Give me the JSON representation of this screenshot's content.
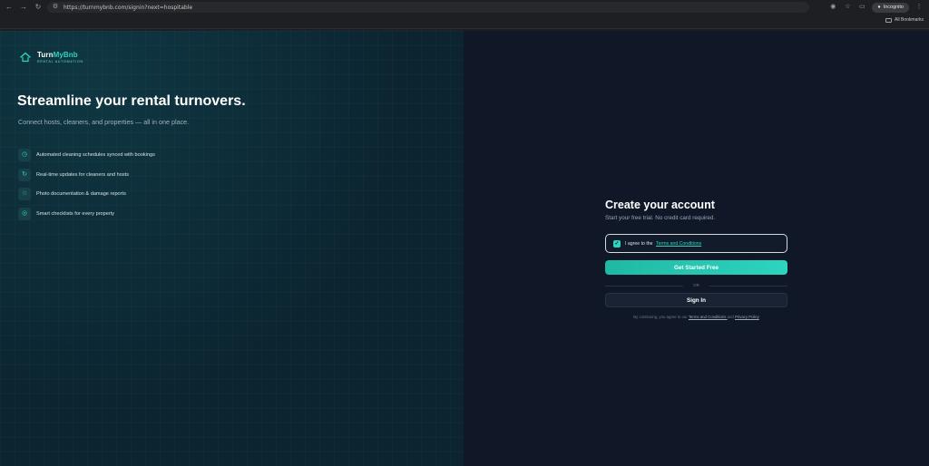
{
  "browser": {
    "url": "https://turnmybnb.com/signin?next=hospitable",
    "mode_label": "Incognito",
    "bookmarks_label": "All Bookmarks"
  },
  "brand": {
    "name_part1": "Turn",
    "name_part2": "MyBnb",
    "tagline": "RENTAL AUTOMATION",
    "accent_color": "#2dd4bf"
  },
  "hero": {
    "headline": "Streamline your rental turnovers.",
    "subheadline": "Connect hosts, cleaners, and properties — all in one place."
  },
  "features": [
    {
      "icon": "clock-icon",
      "text": "Automated cleaning schedules synced with bookings"
    },
    {
      "icon": "refresh-icon",
      "text": "Real-time updates for cleaners and hosts"
    },
    {
      "icon": "camera-icon",
      "text": "Photo documentation & damage reports"
    },
    {
      "icon": "checklist-icon",
      "text": "Smart checklists for every property"
    }
  ],
  "form": {
    "title": "Create your account",
    "subtitle": "Start your free trial. No credit card required.",
    "agree_prefix": "I agree to the",
    "agree_link": "Terms and Conditions",
    "agree_checked": true,
    "primary_button": "Get Started Free",
    "divider_text": "OR",
    "secondary_button": "Sign In",
    "legal_prefix": "By continuing, you agree to our",
    "legal_terms": "Terms and Conditions",
    "legal_and": "and",
    "legal_privacy": "Privacy Policy"
  }
}
